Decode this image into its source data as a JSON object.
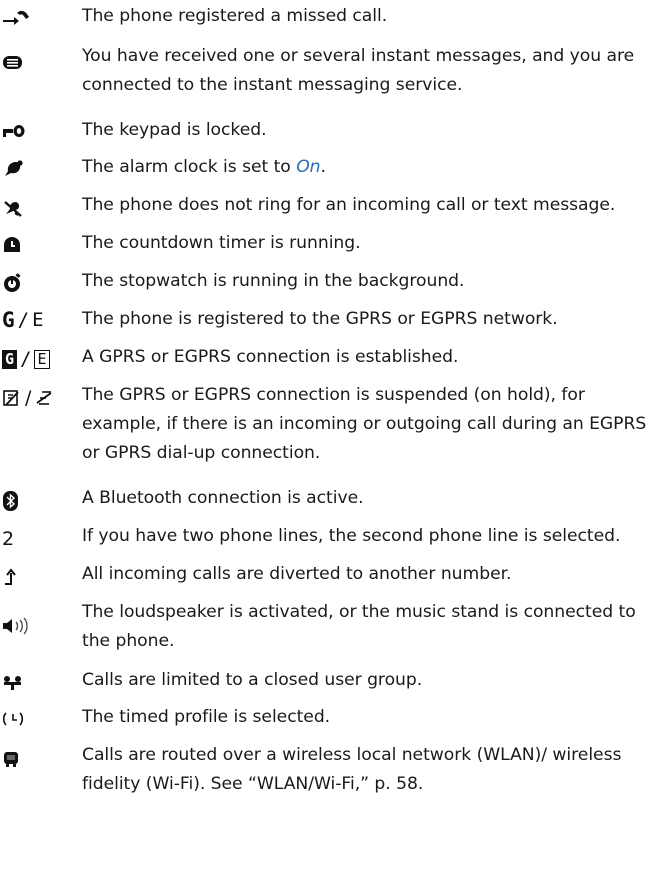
{
  "colors": {
    "text": "#1a1a1a",
    "link": "#2a6db5"
  },
  "rows": [
    {
      "icon": "missed-call-icon",
      "text": "The phone registered a missed call."
    },
    {
      "icon": "instant-message-icon",
      "text": "You have received one or several instant messages, and you are connected to the instant messaging service."
    },
    {
      "icon": "keypad-lock-icon",
      "text": "The keypad is locked."
    },
    {
      "icon": "alarm-clock-icon",
      "text_before": "The alarm clock is set to ",
      "link": "On",
      "text_after": "."
    },
    {
      "icon": "silent-icon",
      "text": "The phone does not ring for an incoming call or text message."
    },
    {
      "icon": "countdown-timer-icon",
      "text": "The countdown timer is running."
    },
    {
      "icon": "stopwatch-icon",
      "text": "The stopwatch is running in the background."
    },
    {
      "icon": "gprs-registered-icon",
      "glyph_a": "G",
      "glyph_b": "E",
      "text": "The phone is registered to the GPRS or EGPRS network."
    },
    {
      "icon": "gprs-connection-icon",
      "glyph_a": "G",
      "glyph_b": "E",
      "text": "A GPRS or EGPRS connection is established."
    },
    {
      "icon": "gprs-suspended-icon",
      "text": "The GPRS or EGPRS connection is suspended (on hold), for example, if there is an incoming or outgoing call during an EGPRS or GPRS dial-up connection."
    },
    {
      "icon": "bluetooth-icon",
      "text": "A Bluetooth connection is active."
    },
    {
      "icon": "second-line-icon",
      "glyph": "2",
      "text": "If you have two phone lines, the second phone line is selected."
    },
    {
      "icon": "call-divert-icon",
      "text": "All incoming calls are diverted to another number."
    },
    {
      "icon": "loudspeaker-icon",
      "text": "The loudspeaker is activated, or the music stand is connected to the phone."
    },
    {
      "icon": "closed-user-group-icon",
      "text": "Calls are limited to a closed user group."
    },
    {
      "icon": "timed-profile-icon",
      "text": "The timed profile is selected."
    },
    {
      "icon": "wlan-call-icon",
      "text": "Calls are routed over a wireless local network (WLAN)/ wireless fidelity (Wi-Fi). See “WLAN/Wi-Fi,” p. 58."
    }
  ]
}
